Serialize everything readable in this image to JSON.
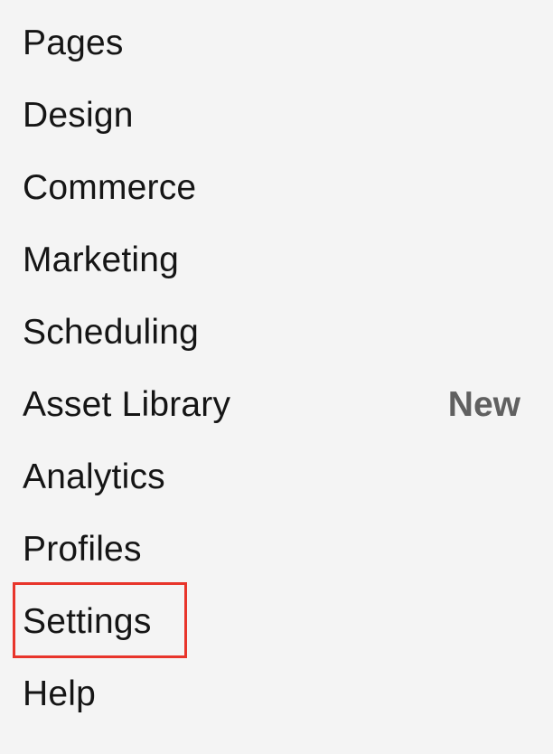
{
  "nav": {
    "items": [
      {
        "label": "Pages"
      },
      {
        "label": "Design"
      },
      {
        "label": "Commerce"
      },
      {
        "label": "Marketing"
      },
      {
        "label": "Scheduling"
      },
      {
        "label": "Asset Library",
        "badge": "New"
      },
      {
        "label": "Analytics"
      },
      {
        "label": "Profiles"
      },
      {
        "label": "Settings",
        "highlighted": true
      },
      {
        "label": "Help"
      }
    ]
  },
  "colors": {
    "background": "#f4f4f4",
    "text": "#151515",
    "badge": "#606060",
    "highlight": "#e8352b"
  }
}
